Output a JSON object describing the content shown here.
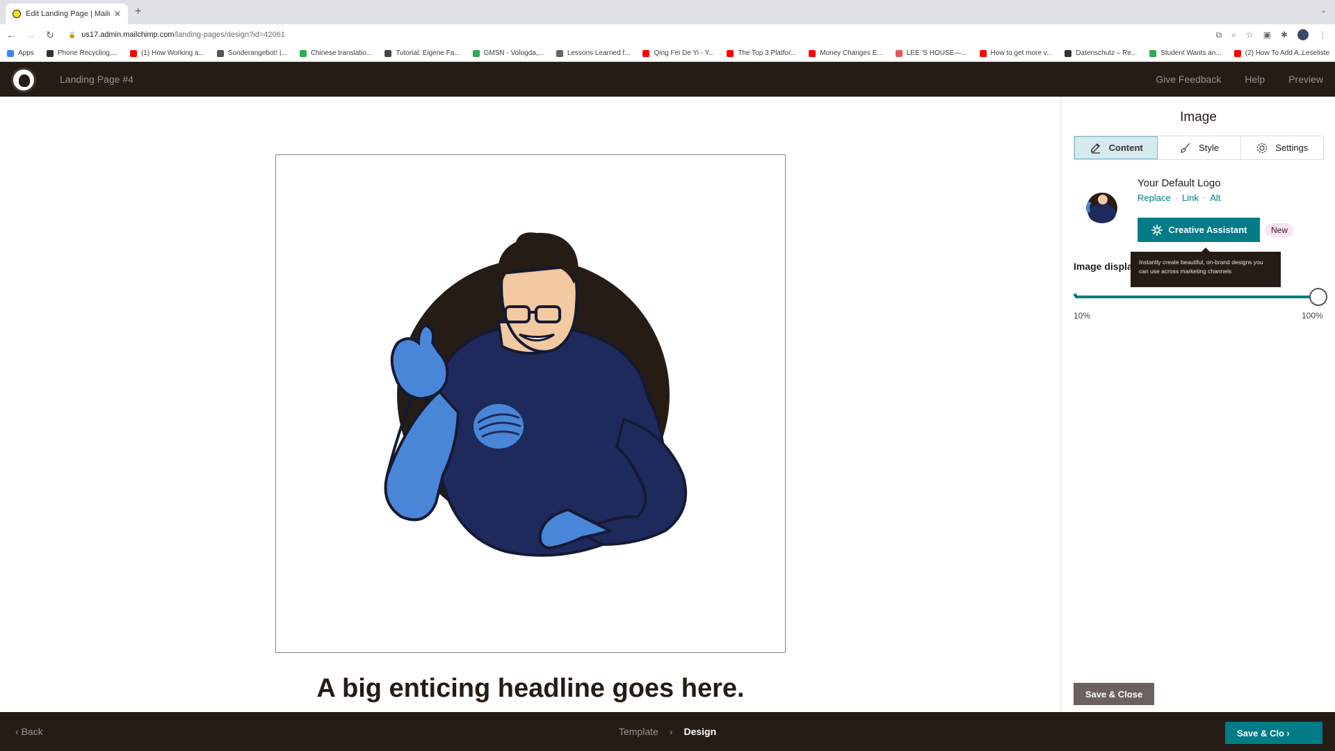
{
  "browser": {
    "tab_title": "Edit Landing Page | Mailchimp",
    "new_tab": "+",
    "url_host": "us17.admin.mailchimp.com",
    "url_path": "/landing-pages/design?id=42061",
    "bookmarks": [
      {
        "label": "Apps",
        "color": "#4285f4"
      },
      {
        "label": "Phone Recycling,...",
        "color": "#333333"
      },
      {
        "label": "(1) How Working a...",
        "color": "#ff0000"
      },
      {
        "label": "Sonderangebot! |...",
        "color": "#555555"
      },
      {
        "label": "Chinese translatio...",
        "color": "#34a853"
      },
      {
        "label": "Tutorial: Eigene Fa...",
        "color": "#444444"
      },
      {
        "label": "GMSN - Vologda,...",
        "color": "#34a853"
      },
      {
        "label": "Lessons Learned f...",
        "color": "#666666"
      },
      {
        "label": "Qing Fei De Yi - Y...",
        "color": "#ff0000"
      },
      {
        "label": "The Top 3 Platfor...",
        "color": "#ff0000"
      },
      {
        "label": "Money Changes E...",
        "color": "#ff0000"
      },
      {
        "label": "LEE 'S HOUSE—...",
        "color": "#e05a5a"
      },
      {
        "label": "How to get more v...",
        "color": "#ff0000"
      },
      {
        "label": "Datenschutz – Re...",
        "color": "#333333"
      },
      {
        "label": "Student Wants an...",
        "color": "#34a853"
      },
      {
        "label": "(2) How To Add A...",
        "color": "#ff0000"
      }
    ],
    "reading_list": "Leseliste"
  },
  "header": {
    "page_name": "Landing Page #4",
    "give_feedback": "Give Feedback",
    "help": "Help",
    "preview": "Preview"
  },
  "canvas": {
    "headline": "A big enticing headline goes here."
  },
  "panel": {
    "title": "Image",
    "tabs": [
      {
        "label": "Content",
        "icon": "pencil-icon"
      },
      {
        "label": "Style",
        "icon": "brush-icon"
      },
      {
        "label": "Settings",
        "icon": "gear-icon"
      }
    ],
    "logo_name": "Your Default Logo",
    "actions": {
      "replace": "Replace",
      "link": "Link",
      "alt": "Alt",
      "sep": "·"
    },
    "creative_assistant": "Creative Assistant",
    "new_badge": "New",
    "tooltip": "Instantly create beautiful, on-brand designs you can use across marketing channels",
    "display_label": "Image display",
    "slider": {
      "min_label": "10%",
      "max_label": "100%",
      "value": 1.0
    },
    "save_close": "Save & Close"
  },
  "footer": {
    "back": "Back",
    "crumb_template": "Template",
    "crumb_design": "Design",
    "save_close": "Save & Clo"
  },
  "colors": {
    "brand_dark": "#241c15",
    "accent_teal": "#007c89",
    "mascot_navy": "#1e2a5c",
    "mascot_blue": "#4a86d8"
  }
}
